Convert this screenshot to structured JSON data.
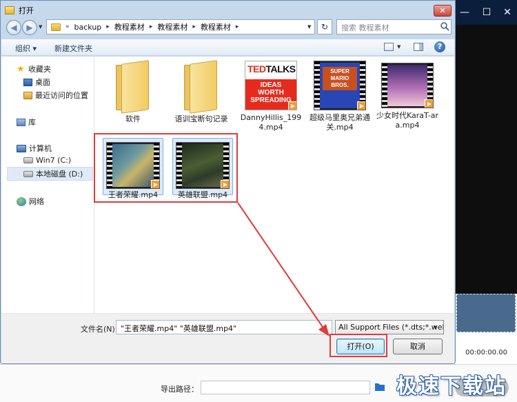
{
  "background_app": {
    "time": "00:00:00.00",
    "export_label": "导出路径：",
    "export_button": "",
    "watermark": "极速下载站"
  },
  "dialog": {
    "title": "打开",
    "close_glyph": "✕",
    "address": {
      "crumbs": [
        "backup",
        "教程素材",
        "教程素材",
        "教程素材"
      ],
      "overflow": "«",
      "separator": "▸"
    },
    "search_placeholder": "搜索 教程素材",
    "toolbar": {
      "organize": "组织 ▾",
      "new_folder": "新建文件夹",
      "help": "?"
    },
    "nav_pane": {
      "favorites": "收藏夹",
      "desktop": "桌面",
      "recent": "最近访问的位置",
      "libraries": "库",
      "computer": "计算机",
      "drive_c": "Win7 (C:)",
      "drive_d": "本地磁盘 (D:)",
      "network": "网络"
    },
    "files": [
      {
        "name": "软件",
        "type": "folder"
      },
      {
        "name": "语训宝断句记录",
        "type": "folder"
      },
      {
        "name": "DannyHillis_1994.mp4",
        "type": "video",
        "ted_top_a": "TED",
        "ted_top_b": "TALKS",
        "ted_block": "IDEAS WORTH SPREADING"
      },
      {
        "name": "超级马里奥兄弟通关.mp4",
        "type": "video"
      },
      {
        "name": "少女时代KaraT-ara.mp4",
        "type": "video"
      },
      {
        "name": "王者荣耀.mp4",
        "type": "video",
        "selected": true
      },
      {
        "name": "英雄联盟.mp4",
        "type": "video",
        "selected": true
      }
    ],
    "mario_text": "SUPER MARIO BROS.",
    "footer": {
      "filename_label": "文件名(N):",
      "filename_value": "\"王者荣耀.mp4\" \"英雄联盟.mp4\"",
      "filter": "All Support Files (*.dts;*.web",
      "open": "打开(O)",
      "cancel": "取消"
    }
  },
  "colors": {
    "annotation_red": "#e13b3b",
    "selection_blue": "#dcebfa"
  }
}
